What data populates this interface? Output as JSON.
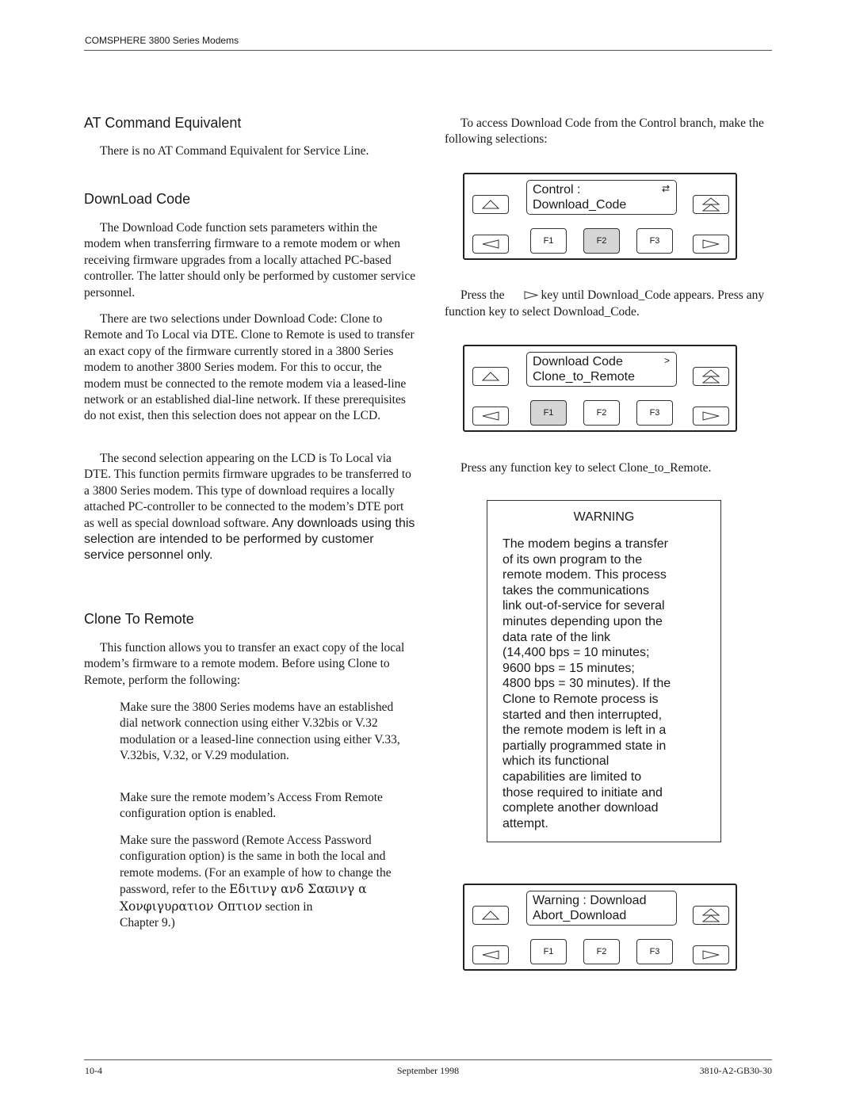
{
  "header": {
    "running_title": "COMSPHERE 3800 Series Modems"
  },
  "footer": {
    "page_number": "10-4",
    "date": "September 1998",
    "doc_number": "3810-A2-GB30-30"
  },
  "left_column": {
    "at_command": {
      "heading": "AT Command Equivalent",
      "text": "There is no AT Command Equivalent for Service Line."
    },
    "download_code": {
      "heading": "DownLoad Code",
      "para1": "The Download Code function sets parameters within the modem when transferring firmware to a remote modem or when receiving firmware upgrades from a locally attached PC-based controller. The latter should only be performed by customer service personnel.",
      "para2": "There are two selections under Download Code: Clone to Remote and To Local via DTE. Clone to Remote is used to transfer an exact copy of the firmware currently stored in a 3800 Series modem to another 3800 Series modem. For this to occur, the modem must be connected to the remote modem via a leased-line network or an established dial-line network. If these prerequisites do not exist, then this selection does not appear on the LCD.",
      "para3_serif": "The second selection appearing on the LCD is To Local via DTE. This function permits firmware upgrades to be transferred to a 3800 Series modem. This type of download requires a locally attached PC-controller to be connected to the modem’s DTE port as well as special download software.",
      "para3_sans": " Any downloads using this selection are intended to be performed by customer service personnel only."
    },
    "clone_to_remote": {
      "heading": "Clone To Remote",
      "intro": "This function allows you to transfer an exact copy of the local modem’s firmware to a remote modem. Before using Clone to Remote, perform the following:",
      "steps": [
        "Make sure the 3800 Series modems have an established dial network connection using either V.32bis or V.32 modulation or a leased-line connection using either V.33, V.32bis, V.32, or V.29 modulation.",
        "Make sure the remote modem’s Access From Remote configuration option is enabled."
      ],
      "step3_a": "Make sure the password (Remote Access Password configuration option) is the same in both the local and remote modems. (For an example of how to change the password, refer to the ",
      "step3_garbled": "Εδιτινγ ανδ Σαϖινγ α Χονφιγυρατιον Οπτιον",
      "step3_b": " section in",
      "step3_c": "Chapter 9.)"
    }
  },
  "right_column": {
    "intro": "To access Download Code from the Control branch, make the following selections:",
    "press_text_a": "Press the",
    "press_text_b": "key until Download_Code appears. Press any function key to select Download_Code.",
    "press_any": "Press any function key to select Clone_to_Remote.",
    "panels": [
      {
        "lcd_line1": "Control :",
        "lcd_line2": "Download_Code",
        "indicator": "⇄",
        "selected_key": "F2",
        "keys": [
          "F1",
          "F2",
          "F3"
        ]
      },
      {
        "lcd_line1": "Download Code",
        "lcd_line2": "Clone_to_Remote",
        "indicator": ">",
        "selected_key": "F1",
        "keys": [
          "F1",
          "F2",
          "F3"
        ]
      },
      {
        "lcd_line1": "Warning : Download",
        "lcd_line2": "Abort_Download",
        "indicator": "",
        "selected_key": "",
        "keys": [
          "F1",
          "F2",
          "F3"
        ]
      }
    ],
    "warning": {
      "title": "WARNING",
      "body": "The modem begins a transfer\nof its own program to the\nremote modem. This process\ntakes the communications\nlink out-of-service for several\nminutes depending upon the\ndata rate of the link\n(14,400 bps = 10 minutes;\n9600 bps = 15 minutes;\n4800 bps = 30 minutes). If the\nClone to Remote process is\nstarted and then interrupted,\nthe remote modem is left in a\npartially programmed state in\nwhich its functional\ncapabilities are limited to\nthose required to initiate and\ncomplete another download\nattempt."
    }
  }
}
